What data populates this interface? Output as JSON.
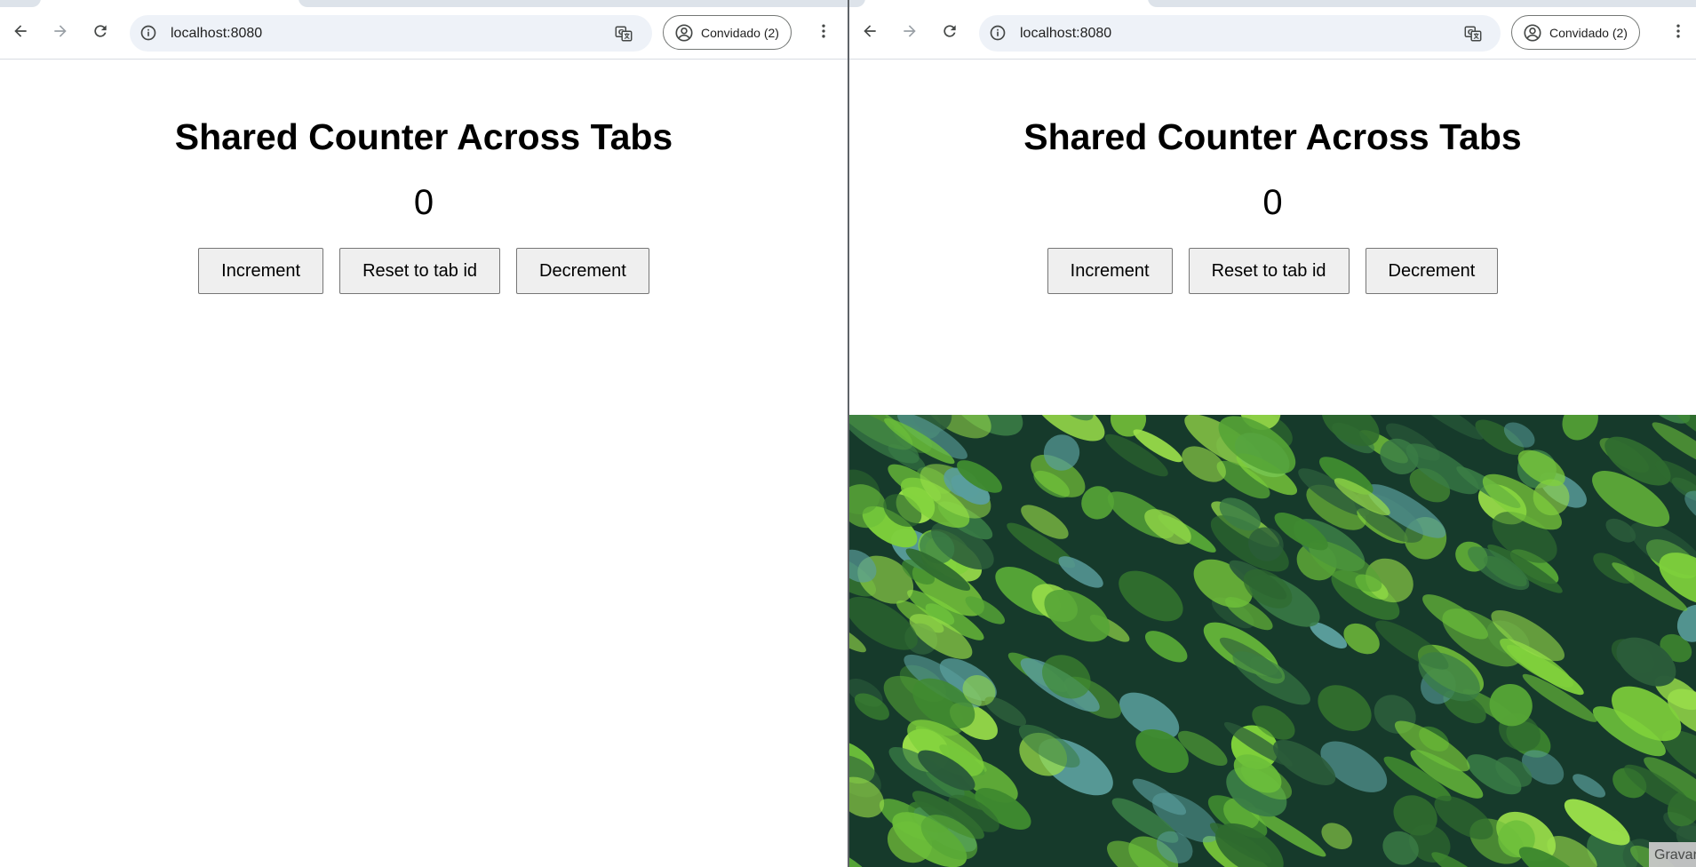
{
  "windows": [
    {
      "omnibox": {
        "url": "localhost:8080"
      },
      "profile": {
        "label": "Convidado (2)"
      },
      "page": {
        "title": "Shared Counter Across Tabs",
        "counter_value": "0",
        "buttons": {
          "increment": "Increment",
          "reset": "Reset to tab id",
          "decrement": "Decrement"
        }
      }
    },
    {
      "omnibox": {
        "url": "localhost:8080"
      },
      "profile": {
        "label": "Convidado (2)"
      },
      "page": {
        "title": "Shared Counter Across Tabs",
        "counter_value": "0",
        "buttons": {
          "increment": "Increment",
          "reset": "Reset to tab id",
          "decrement": "Decrement"
        }
      }
    }
  ],
  "overlay": {
    "record_label": "Gravar"
  },
  "icons": {
    "back": "arrow-left-icon",
    "forward": "arrow-right-icon",
    "reload": "reload-icon",
    "site_info": "info-icon",
    "translate": "translate-icon",
    "profile": "account-circle-icon",
    "menu": "more-vert-icon"
  },
  "colors": {
    "omnibox_bg": "#eef2f8",
    "button_bg": "#efefef",
    "forest_dark": "#173e2c",
    "forest_light": "#7fd13b"
  }
}
